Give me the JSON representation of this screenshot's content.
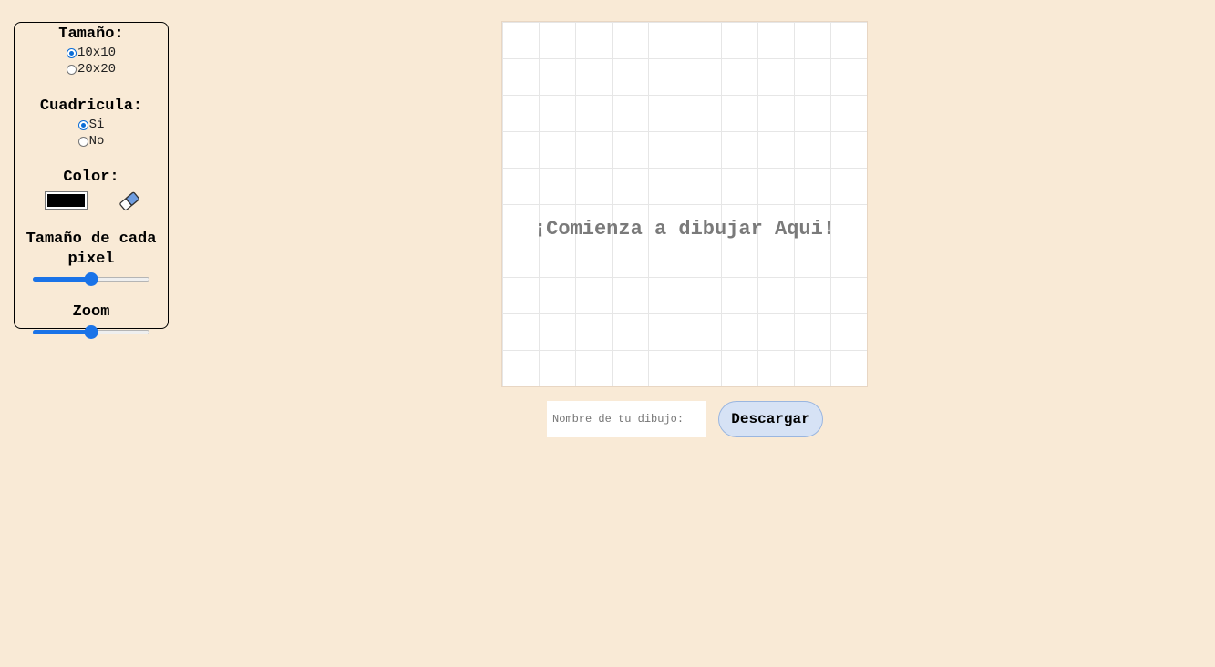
{
  "sidebar": {
    "size": {
      "title": "Tamaño:",
      "options": [
        {
          "label": "10x10",
          "checked": true
        },
        {
          "label": "20x20",
          "checked": false
        }
      ]
    },
    "grid": {
      "title": "Cuadricula:",
      "options": [
        {
          "label": "Si",
          "checked": true
        },
        {
          "label": "No",
          "checked": false
        }
      ]
    },
    "color": {
      "title": "Color:",
      "value": "#000000",
      "eraser_icon": "eraser-icon"
    },
    "pixel_size": {
      "title": "Tamaño de cada pixel",
      "value_fraction": 0.5
    },
    "zoom": {
      "title": "Zoom",
      "value_fraction": 0.5
    }
  },
  "canvas": {
    "prompt": "¡Comienza a dibujar Aqui!",
    "grid_cells": 10
  },
  "footer": {
    "name_placeholder": "Nombre de tu dibujo:",
    "download_label": "Descargar"
  },
  "colors": {
    "background": "#f9ead6",
    "accent": "#1a73e8",
    "button_bg": "#d6e2f5"
  }
}
